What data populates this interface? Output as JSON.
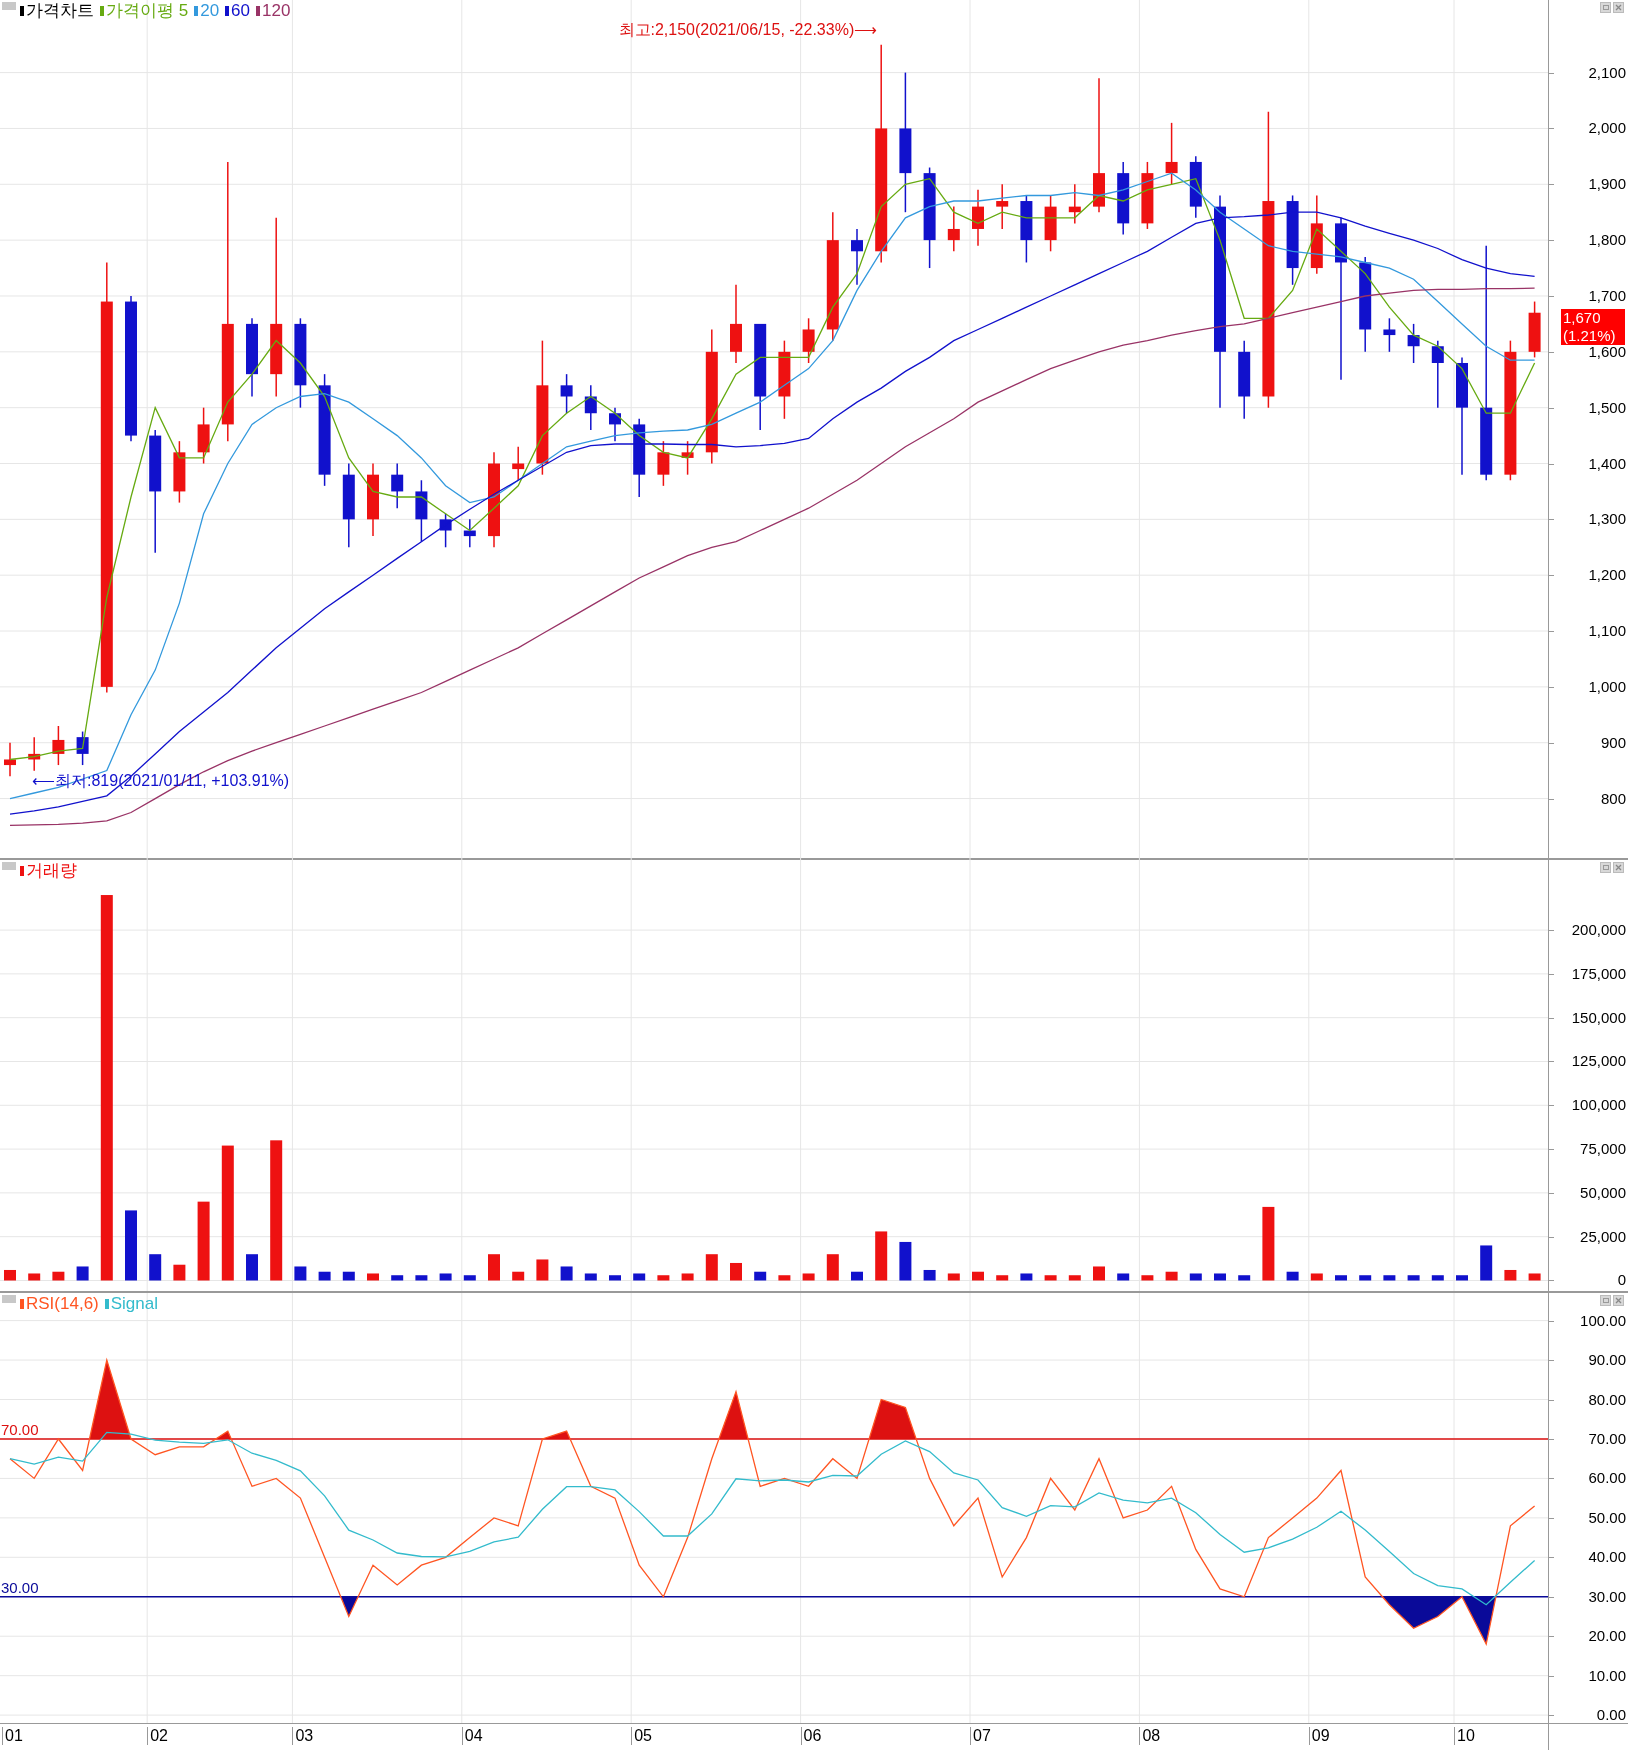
{
  "price_pane": {
    "candle_legend": {
      "name": "가격차트",
      "color": "#000000"
    },
    "chart_data": {
      "type": "candlestick",
      "grid": true,
      "legend": true,
      "categories": [
        null,
        null,
        null,
        null,
        null,
        null,
        null,
        null,
        null,
        null,
        null,
        null,
        null,
        null,
        null,
        null,
        null,
        null,
        null,
        null,
        null,
        null,
        null,
        null,
        null,
        null,
        null,
        null,
        null,
        null,
        null,
        null,
        null,
        null,
        null,
        null,
        null,
        null,
        null,
        null,
        null,
        null,
        null,
        null,
        null,
        null,
        null,
        null,
        null,
        null,
        null,
        null,
        null,
        null,
        null,
        null,
        null,
        null,
        null,
        null,
        null,
        null,
        null,
        null
      ],
      "ohlc": [
        [
          860,
          900,
          840,
          870
        ],
        [
          870,
          910,
          850,
          880
        ],
        [
          880,
          930,
          860,
          905
        ],
        [
          910,
          920,
          860,
          880
        ],
        [
          1000,
          1760,
          990,
          1690
        ],
        [
          1690,
          1700,
          1440,
          1450
        ],
        [
          1450,
          1460,
          1240,
          1350
        ],
        [
          1350,
          1440,
          1330,
          1420
        ],
        [
          1420,
          1500,
          1400,
          1470
        ],
        [
          1470,
          1940,
          1440,
          1650
        ],
        [
          1650,
          1660,
          1520,
          1560
        ],
        [
          1560,
          1840,
          1520,
          1650
        ],
        [
          1650,
          1660,
          1500,
          1540
        ],
        [
          1540,
          1560,
          1360,
          1380
        ],
        [
          1380,
          1400,
          1250,
          1300
        ],
        [
          1300,
          1400,
          1270,
          1380
        ],
        [
          1380,
          1400,
          1320,
          1350
        ],
        [
          1350,
          1370,
          1260,
          1300
        ],
        [
          1300,
          1310,
          1250,
          1280
        ],
        [
          1280,
          1300,
          1250,
          1270
        ],
        [
          1270,
          1420,
          1250,
          1400
        ],
        [
          1390,
          1430,
          1370,
          1400
        ],
        [
          1400,
          1620,
          1380,
          1540
        ],
        [
          1540,
          1560,
          1490,
          1520
        ],
        [
          1520,
          1540,
          1460,
          1490
        ],
        [
          1490,
          1500,
          1440,
          1470
        ],
        [
          1470,
          1480,
          1340,
          1380
        ],
        [
          1380,
          1440,
          1360,
          1420
        ],
        [
          1410,
          1440,
          1380,
          1420
        ],
        [
          1420,
          1640,
          1400,
          1600
        ],
        [
          1600,
          1720,
          1580,
          1650
        ],
        [
          1650,
          1650,
          1460,
          1520
        ],
        [
          1520,
          1620,
          1480,
          1600
        ],
        [
          1600,
          1660,
          1580,
          1640
        ],
        [
          1640,
          1850,
          1620,
          1800
        ],
        [
          1800,
          1820,
          1720,
          1780
        ],
        [
          1780,
          2150,
          1760,
          2000
        ],
        [
          2000,
          2100,
          1850,
          1920
        ],
        [
          1920,
          1930,
          1750,
          1800
        ],
        [
          1800,
          1860,
          1780,
          1820
        ],
        [
          1820,
          1890,
          1790,
          1860
        ],
        [
          1860,
          1900,
          1820,
          1870
        ],
        [
          1870,
          1880,
          1760,
          1800
        ],
        [
          1800,
          1880,
          1780,
          1860
        ],
        [
          1850,
          1900,
          1830,
          1860
        ],
        [
          1860,
          2090,
          1850,
          1920
        ],
        [
          1920,
          1940,
          1810,
          1830
        ],
        [
          1830,
          1940,
          1820,
          1920
        ],
        [
          1920,
          2010,
          1900,
          1940
        ],
        [
          1940,
          1950,
          1840,
          1860
        ],
        [
          1860,
          1880,
          1500,
          1600
        ],
        [
          1600,
          1620,
          1480,
          1520
        ],
        [
          1520,
          2030,
          1500,
          1870
        ],
        [
          1870,
          1880,
          1720,
          1750
        ],
        [
          1750,
          1880,
          1740,
          1830
        ],
        [
          1830,
          1840,
          1550,
          1760
        ],
        [
          1760,
          1770,
          1600,
          1640
        ],
        [
          1640,
          1660,
          1600,
          1630
        ],
        [
          1630,
          1650,
          1580,
          1610
        ],
        [
          1610,
          1620,
          1500,
          1580
        ],
        [
          1580,
          1590,
          1380,
          1500
        ],
        [
          1500,
          1790,
          1370,
          1380
        ],
        [
          1380,
          1620,
          1370,
          1600
        ],
        [
          1600,
          1690,
          1590,
          1670
        ]
      ],
      "series": [
        {
          "name": "가격이평 5",
          "color": "#66aa11",
          "type": "line",
          "values": [
            870,
            875,
            885,
            890,
            1160,
            1340,
            1500,
            1410,
            1410,
            1510,
            1560,
            1620,
            1580,
            1520,
            1410,
            1350,
            1340,
            1340,
            1310,
            1280,
            1320,
            1360,
            1450,
            1490,
            1520,
            1490,
            1450,
            1420,
            1410,
            1480,
            1560,
            1590,
            1590,
            1590,
            1680,
            1740,
            1860,
            1900,
            1910,
            1850,
            1830,
            1850,
            1840,
            1840,
            1840,
            1880,
            1870,
            1890,
            1900,
            1910,
            1800,
            1660,
            1660,
            1710,
            1820,
            1780,
            1740,
            1680,
            1630,
            1610,
            1570,
            1490,
            1490,
            1580
          ]
        },
        {
          "name": "20",
          "color": "#3399dd",
          "type": "line",
          "values": [
            800,
            810,
            820,
            835,
            850,
            950,
            1030,
            1150,
            1310,
            1400,
            1470,
            1500,
            1520,
            1525,
            1510,
            1480,
            1450,
            1410,
            1360,
            1330,
            1340,
            1370,
            1400,
            1430,
            1440,
            1450,
            1455,
            1458,
            1460,
            1470,
            1490,
            1510,
            1540,
            1570,
            1620,
            1710,
            1780,
            1840,
            1860,
            1870,
            1870,
            1875,
            1880,
            1880,
            1885,
            1880,
            1890,
            1905,
            1920,
            1890,
            1850,
            1820,
            1790,
            1780,
            1775,
            1770,
            1760,
            1750,
            1730,
            1690,
            1650,
            1610,
            1585,
            1585
          ]
        },
        {
          "name": "60",
          "color": "#1111cc",
          "type": "line",
          "values": [
            772,
            778,
            785,
            795,
            805,
            840,
            880,
            920,
            955,
            990,
            1030,
            1070,
            1105,
            1140,
            1170,
            1200,
            1230,
            1260,
            1290,
            1318,
            1345,
            1370,
            1395,
            1420,
            1432,
            1435,
            1435,
            1435,
            1434,
            1434,
            1430,
            1432,
            1436,
            1445,
            1480,
            1510,
            1535,
            1565,
            1590,
            1620,
            1640,
            1660,
            1680,
            1700,
            1720,
            1740,
            1760,
            1780,
            1805,
            1830,
            1840,
            1842,
            1845,
            1850,
            1850,
            1840,
            1825,
            1812,
            1800,
            1785,
            1765,
            1750,
            1740,
            1735
          ]
        },
        {
          "name": "120",
          "color": "#993366",
          "type": "line",
          "values": [
            752,
            753,
            754,
            756,
            760,
            775,
            800,
            825,
            848,
            868,
            885,
            900,
            915,
            930,
            945,
            960,
            975,
            990,
            1010,
            1030,
            1050,
            1070,
            1095,
            1120,
            1145,
            1170,
            1195,
            1215,
            1235,
            1250,
            1260,
            1280,
            1300,
            1320,
            1345,
            1370,
            1400,
            1430,
            1455,
            1480,
            1510,
            1530,
            1550,
            1570,
            1585,
            1600,
            1612,
            1620,
            1630,
            1638,
            1645,
            1650,
            1660,
            1670,
            1680,
            1690,
            1700,
            1705,
            1710,
            1712,
            1712,
            1713,
            1713,
            1714
          ]
        }
      ],
      "ylim": [
        690,
        2230
      ],
      "yticks": [
        {
          "value": 2100,
          "label": "2,100"
        },
        {
          "value": 2000,
          "label": "2,000"
        },
        {
          "value": 1900,
          "label": "1,900"
        },
        {
          "value": 1800,
          "label": "1,800"
        },
        {
          "value": 1700,
          "label": "1,700"
        },
        {
          "value": 1600,
          "label": "1,600"
        },
        {
          "value": 1500,
          "label": "1,500"
        },
        {
          "value": 1400,
          "label": "1,400"
        },
        {
          "value": 1300,
          "label": "1,300"
        },
        {
          "value": 1200,
          "label": "1,200"
        },
        {
          "value": 1100,
          "label": "1,100"
        },
        {
          "value": 1000,
          "label": "1,000"
        },
        {
          "value": 900,
          "label": "900"
        },
        {
          "value": 800,
          "label": "800"
        }
      ],
      "annotations": [
        "최고:2,150(2021/06/15, -22.33%)⟶",
        "⟵최저:819(2021/01/11, +103.91%)"
      ]
    },
    "current_price": {
      "price": "1,670",
      "change": "(1.21%)"
    }
  },
  "volume_pane": {
    "chart_data": {
      "type": "bar",
      "grid": true,
      "legend": true,
      "categories": [
        null,
        null,
        null,
        null,
        null,
        null,
        null,
        null,
        null,
        null,
        null,
        null,
        null,
        null,
        null,
        null,
        null,
        null,
        null,
        null,
        null,
        null,
        null,
        null,
        null,
        null,
        null,
        null,
        null,
        null,
        null,
        null,
        null,
        null,
        null,
        null,
        null,
        null,
        null,
        null,
        null,
        null,
        null,
        null,
        null,
        null,
        null,
        null,
        null,
        null,
        null,
        null,
        null,
        null,
        null,
        null,
        null,
        null,
        null,
        null,
        null,
        null,
        null,
        null
      ],
      "series": [
        {
          "name": "거래량",
          "color": "#ee1111",
          "colors": [
            "#ee1111",
            "#ee1111",
            "#ee1111",
            "#1111cc",
            "#ee1111",
            "#1111cc",
            "#1111cc",
            "#ee1111",
            "#ee1111",
            "#ee1111",
            "#1111cc",
            "#ee1111",
            "#1111cc",
            "#1111cc",
            "#1111cc",
            "#ee1111",
            "#1111cc",
            "#1111cc",
            "#1111cc",
            "#1111cc",
            "#ee1111",
            "#ee1111",
            "#ee1111",
            "#1111cc",
            "#1111cc",
            "#1111cc",
            "#1111cc",
            "#ee1111",
            "#ee1111",
            "#ee1111",
            "#ee1111",
            "#1111cc",
            "#ee1111",
            "#ee1111",
            "#ee1111",
            "#1111cc",
            "#ee1111",
            "#1111cc",
            "#1111cc",
            "#ee1111",
            "#ee1111",
            "#ee1111",
            "#1111cc",
            "#ee1111",
            "#ee1111",
            "#ee1111",
            "#1111cc",
            "#ee1111",
            "#ee1111",
            "#1111cc",
            "#1111cc",
            "#1111cc",
            "#ee1111",
            "#1111cc",
            "#ee1111",
            "#1111cc",
            "#1111cc",
            "#1111cc",
            "#1111cc",
            "#1111cc",
            "#1111cc",
            "#1111cc",
            "#ee1111",
            "#ee1111"
          ],
          "values": [
            6000,
            4000,
            5000,
            8000,
            220000,
            40000,
            15000,
            9000,
            45000,
            77000,
            15000,
            80000,
            8000,
            5000,
            5000,
            4000,
            3000,
            3000,
            4000,
            3000,
            15000,
            5000,
            12000,
            8000,
            4000,
            3000,
            4000,
            3000,
            4000,
            15000,
            10000,
            5000,
            3000,
            4000,
            15000,
            5000,
            28000,
            22000,
            6000,
            4000,
            5000,
            3000,
            4000,
            3000,
            3000,
            8000,
            4000,
            3000,
            5000,
            4000,
            4000,
            3000,
            42000,
            5000,
            4000,
            3000,
            3000,
            3000,
            3000,
            3000,
            3000,
            20000,
            6000,
            4000
          ]
        }
      ],
      "ylim": [
        -6000,
        240000
      ],
      "yticks": [
        {
          "value": 200000,
          "label": "200,000"
        },
        {
          "value": 175000,
          "label": "175,000"
        },
        {
          "value": 150000,
          "label": "150,000"
        },
        {
          "value": 125000,
          "label": "125,000"
        },
        {
          "value": 100000,
          "label": "100,000"
        },
        {
          "value": 75000,
          "label": "75,000"
        },
        {
          "value": 50000,
          "label": "50,000"
        },
        {
          "value": 25000,
          "label": "25,000"
        },
        {
          "value": 0,
          "label": "0"
        }
      ]
    }
  },
  "rsi_pane": {
    "chart_data": {
      "type": "line",
      "grid": true,
      "legend": true,
      "categories": [
        "01",
        null,
        null,
        null,
        null,
        null,
        "02",
        null,
        null,
        null,
        null,
        null,
        "03",
        null,
        null,
        null,
        null,
        null,
        null,
        "04",
        null,
        null,
        null,
        null,
        null,
        null,
        "05",
        null,
        null,
        null,
        null,
        null,
        null,
        "06",
        null,
        null,
        null,
        null,
        null,
        null,
        "07",
        null,
        null,
        null,
        null,
        null,
        null,
        "08",
        null,
        null,
        null,
        null,
        null,
        null,
        "09",
        null,
        null,
        null,
        null,
        null,
        "10",
        null,
        null,
        null
      ],
      "series": [
        {
          "name": "RSI(14,6)",
          "color": "#ff5522",
          "values": [
            65,
            60,
            70,
            62,
            90,
            70,
            66,
            68,
            68,
            72,
            58,
            60,
            55,
            40,
            25,
            38,
            33,
            38,
            40,
            45,
            50,
            48,
            70,
            72,
            58,
            55,
            38,
            30,
            45,
            65,
            82,
            58,
            60,
            58,
            65,
            60,
            80,
            78,
            60,
            48,
            55,
            35,
            45,
            60,
            52,
            65,
            50,
            52,
            58,
            42,
            32,
            30,
            45,
            50,
            55,
            62,
            35,
            28,
            22,
            25,
            30,
            18,
            48,
            53
          ]
        },
        {
          "name": "Signal",
          "color": "#33bbcc",
          "values": [
            65,
            63.6,
            65.4,
            64.4,
            71.7,
            71.2,
            69.7,
            69.2,
            68.9,
            69.8,
            66.4,
            64.6,
            61.9,
            55.6,
            46.9,
            44.4,
            41.1,
            40.2,
            40.1,
            41.5,
            43.9,
            45.1,
            52.2,
            57.9,
            57.9,
            57.1,
            51.6,
            45.4,
            45.4,
            51,
            59.9,
            59.4,
            59.6,
            59.1,
            60.8,
            60.6,
            66.1,
            69.5,
            66.8,
            61.4,
            59.6,
            52.6,
            50.4,
            53.1,
            52.8,
            56.3,
            54.5,
            53.8,
            55,
            51.3,
            45.8,
            41.3,
            42.4,
            44.6,
            47.6,
            51.7,
            46.9,
            41.5,
            35.9,
            32.8,
            32,
            28,
            33.7,
            39.2
          ]
        }
      ],
      "ylim": [
        -2,
        107
      ],
      "yticks": [
        {
          "value": 100,
          "label": "100.00"
        },
        {
          "value": 90,
          "label": "90.00"
        },
        {
          "value": 80,
          "label": "80.00"
        },
        {
          "value": 70,
          "label": "70.00"
        },
        {
          "value": 60,
          "label": "60.00"
        },
        {
          "value": 50,
          "label": "50.00"
        },
        {
          "value": 40,
          "label": "40.00"
        },
        {
          "value": 30,
          "label": "30.00"
        },
        {
          "value": 20,
          "label": "20.00"
        },
        {
          "value": 10,
          "label": "10.00"
        },
        {
          "value": 0,
          "label": "0.00"
        }
      ],
      "ref_lines": [
        {
          "axis": "y",
          "value": 70,
          "label": "70.00",
          "color": "#dd1111"
        },
        {
          "axis": "y",
          "value": 30,
          "label": "30.00",
          "color": "#0a0a99"
        }
      ]
    }
  }
}
